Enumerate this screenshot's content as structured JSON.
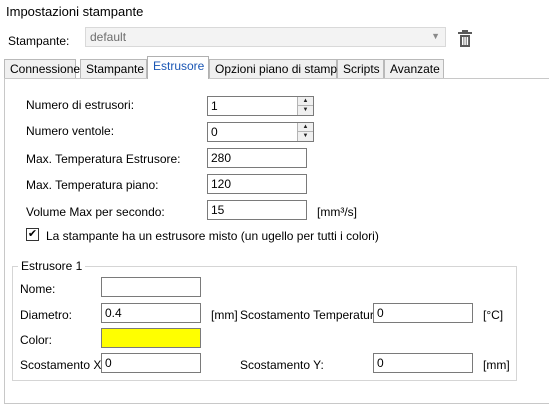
{
  "window": {
    "title": "Impostazioni stampante"
  },
  "printer": {
    "label": "Stampante:",
    "value": "default"
  },
  "tabs": [
    {
      "label": "Connessione"
    },
    {
      "label": "Stampante"
    },
    {
      "label": "Estrusore"
    },
    {
      "label": "Opzioni piano di stampa"
    },
    {
      "label": "Scripts"
    },
    {
      "label": "Avanzate"
    }
  ],
  "extruder": {
    "num_extruders_label": "Numero di estrusori:",
    "num_extruders_value": "1",
    "num_fans_label": "Numero ventole:",
    "num_fans_value": "0",
    "max_temp_label": "Max. Temperatura Estrusore:",
    "max_temp_value": "280",
    "max_bed_temp_label": "Max. Temperatura piano:",
    "max_bed_temp_value": "120",
    "max_volume_label": "Volume Max per secondo:",
    "max_volume_value": "15",
    "max_volume_unit": "[mm³/s]",
    "mixing_checkbox_label": "La stampante ha un estrusore misto (un ugello per tutti i colori)",
    "mixing_checked": true
  },
  "extruder1": {
    "group_title": "Estrusore 1",
    "name_label": "Nome:",
    "name_value": "",
    "diameter_label": "Diametro:",
    "diameter_value": "0.4",
    "diameter_unit": "[mm]",
    "temp_offset_label": "Scostamento Temperatura:",
    "temp_offset_value": "0",
    "temp_offset_unit": "[°C]",
    "color_label": "Color:",
    "color_value": "#ffff00",
    "offset_x_label": "Scostamento X:",
    "offset_x_value": "0",
    "offset_y_label": "Scostamento Y:",
    "offset_y_value": "0",
    "offset_y_unit": "[mm]"
  },
  "icons": {
    "trash": "trash-icon",
    "dropdown": "chevron-down-icon",
    "spin_up": "spin-up-icon",
    "spin_down": "spin-down-icon",
    "check": "checkmark-icon"
  }
}
